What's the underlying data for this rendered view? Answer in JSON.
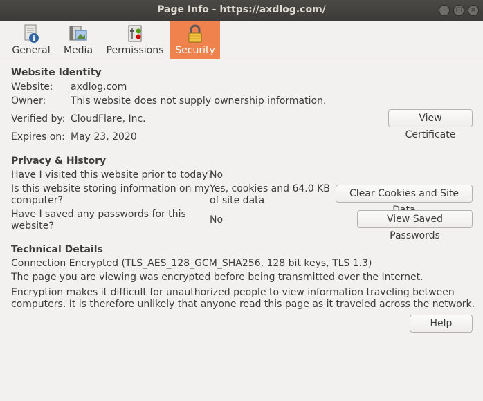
{
  "window": {
    "title": "Page Info - https://axdlog.com/"
  },
  "tabs": [
    {
      "label": "General",
      "icon": "document-info-icon",
      "active": false
    },
    {
      "label": "Media",
      "icon": "media-icon",
      "active": false
    },
    {
      "label": "Permissions",
      "icon": "permissions-icon",
      "active": false
    },
    {
      "label": "Security",
      "icon": "lock-icon",
      "active": true
    }
  ],
  "identity": {
    "heading": "Website Identity",
    "website_label": "Website:",
    "website_value": "axdlog.com",
    "owner_label": "Owner:",
    "owner_value": "This website does not supply ownership information.",
    "verified_label": "Verified by:",
    "verified_value": "CloudFlare, Inc.",
    "expires_label": "Expires on:",
    "expires_value": "May 23, 2020",
    "view_cert_label": "View Certificate"
  },
  "privacy": {
    "heading": "Privacy & History",
    "visited_q": "Have I visited this website prior to today?",
    "visited_a": "No",
    "storing_q1": "Is this website storing information on my",
    "storing_q2": "computer?",
    "storing_a1": "Yes, cookies and 64.0 KB",
    "storing_a2": "of site data",
    "clear_label": "Clear Cookies and Site Data",
    "passwords_q1": "Have I saved any passwords for this",
    "passwords_q2": "website?",
    "passwords_a": "No",
    "view_pw_label": "View Saved Passwords"
  },
  "technical": {
    "heading": "Technical Details",
    "line1": "Connection Encrypted (TLS_AES_128_GCM_SHA256, 128 bit keys, TLS 1.3)",
    "line2": "The page you are viewing was encrypted before being transmitted over the Internet.",
    "line3": "Encryption makes it difficult for unauthorized people to view information traveling between",
    "line4": "computers. It is therefore unlikely that anyone read this page as it traveled across the network."
  },
  "help_label": "Help",
  "colors": {
    "accent": "#f0824e",
    "titlebar": "#3c3b37",
    "background": "#f2f1f0"
  }
}
